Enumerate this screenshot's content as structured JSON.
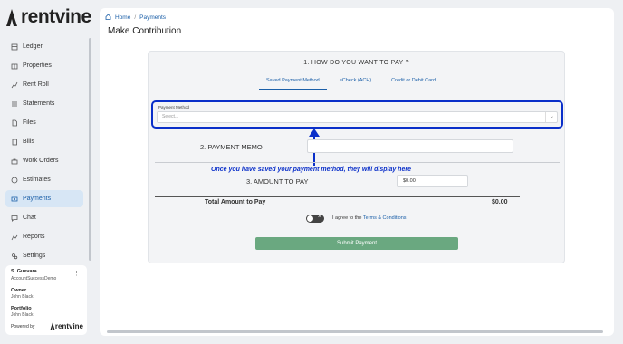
{
  "app": {
    "logo_text": "rentvine"
  },
  "sidebar": {
    "items": [
      {
        "label": "Ledger",
        "icon": "ledger-icon"
      },
      {
        "label": "Properties",
        "icon": "properties-icon"
      },
      {
        "label": "Rent Roll",
        "icon": "rent-roll-icon"
      },
      {
        "label": "Statements",
        "icon": "statements-icon"
      },
      {
        "label": "Files",
        "icon": "files-icon"
      },
      {
        "label": "Bills",
        "icon": "bills-icon"
      },
      {
        "label": "Work Orders",
        "icon": "work-orders-icon"
      },
      {
        "label": "Estimates",
        "icon": "estimates-icon"
      },
      {
        "label": "Payments",
        "icon": "payments-icon",
        "active": true
      },
      {
        "label": "Chat",
        "icon": "chat-icon"
      },
      {
        "label": "Reports",
        "icon": "reports-icon"
      },
      {
        "label": "Settings",
        "icon": "settings-icon"
      }
    ],
    "user": {
      "name": "S. Guevara",
      "account": "AccountSuccessDemo",
      "owner_label": "Owner",
      "owner_value": "John Black",
      "portfolio_label": "Portfolio",
      "portfolio_value": "John Black",
      "powered_by": "Powered by",
      "powered_logo": "rentvine"
    }
  },
  "breadcrumb": {
    "home": "Home",
    "separator": "/",
    "current": "Payments"
  },
  "page_title": "Make Contribution",
  "form": {
    "step1_title": "1. HOW DO YOU WANT TO PAY ?",
    "tabs": [
      {
        "label": "Saved Payment Method",
        "active": true
      },
      {
        "label": "eCheck (ACH)"
      },
      {
        "label": "Credit or Debit Card"
      }
    ],
    "payment_method_label": "Payment Method",
    "payment_method_placeholder": "Select...",
    "memo_label": "2. PAYMENT MEMO",
    "memo_value": "",
    "annotation": "Once you have saved your payment method, they will display here",
    "amount_label": "3. AMOUNT TO PAY",
    "amount_value": "$0.00",
    "total_label": "Total Amount to Pay",
    "total_value": "$0.00",
    "agree_text": "I agree to the",
    "terms_link": "Terms & Conditions",
    "submit_label": "Submit Payment"
  },
  "colors": {
    "accent": "#1b5fa8",
    "highlight": "#0a2fc9",
    "submit": "#6aa880"
  }
}
